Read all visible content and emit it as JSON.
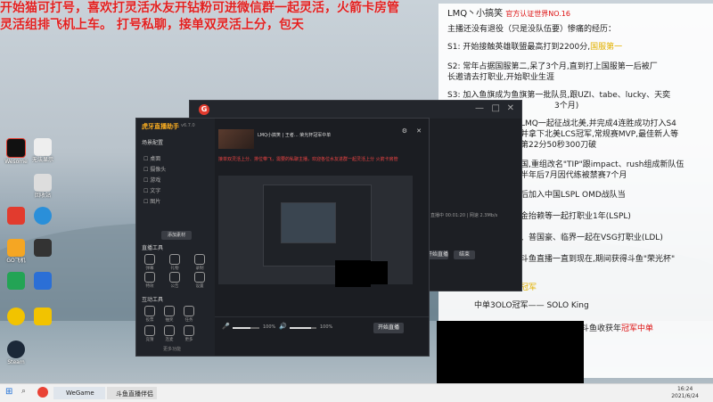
{
  "announcement": {
    "line1": "开始猫可打号，喜欢打灵活水友开钻粉可进微信群一起灵活，火箭卡房管",
    "line2": "灵活组排飞机上车。 打号私聊，接单双灵活上分，包天"
  },
  "desktop_icons": [
    {
      "label": "Wesome",
      "color": "#111111"
    },
    {
      "label": "无法显示",
      "color": "#e8e8e8"
    },
    {
      "label": "回收站",
      "color": "#dddddd"
    },
    {
      "label": "",
      "color": "#2a8fd9"
    },
    {
      "label": "",
      "color": "#e23b2e"
    },
    {
      "label": "GO飞机",
      "color": "#f5a623"
    },
    {
      "label": "",
      "color": "#23a455"
    },
    {
      "label": "",
      "color": "#2b6fd6"
    },
    {
      "label": "",
      "color": "#f2c300"
    },
    {
      "label": "Steam",
      "color": "#1b2838"
    }
  ],
  "bio": {
    "name": "LMQ丶小搞笑",
    "badge": "官方认证世界NO.16",
    "intro": "主播还没有退役（只是没队伍要）惨痛的经历：",
    "s1": "S1:  开始接触英雄联盟最高打到2200分,",
    "s1_hl": "国服第一",
    "s2a": "S2:  常年占据国服第二,呆了3个月,直到打上国服第一后被厂",
    "s2b": "长邀请去打职业,开始职业生涯",
    "s3a": "S3:  加入鱼旗成为鱼旗第一批队员,跟UZI、tabe、lucky、天奕",
    "s3b": "3个月)",
    "l1": "LMQ一起征战北美,并完成4连胜成功打入S4",
    "l2": "并拿下北美LCS冠军,常规赛MVP,最佳新人等",
    "l3": "第22分50秒300刀破",
    "l4": "国,重组改名\"TIP\"跟impact、rush组成新队伍",
    "l5": "半年后7月因代练被禁赛7个月",
    "l6": "后加入中国LSPL OMD战队当",
    "l7": "金抬赖等一起打职业1年(LSPL)",
    "l8": "、普国豪、临界一起在VSG打职业(LDL)",
    "l9": "斗鱼直播一直到现在,期间获得斗鱼\"荣光杯\"",
    "l10": "冠军",
    "l11": "中单3OLO冠军——   SOLO King",
    "l12": "斗鱼收获年",
    "l12_hl": "冠军中单"
  },
  "back_window": {
    "logo": "G",
    "status": "直播中 00:01:20 | 网速 2.3Mb/s",
    "buttons": [
      "开始直播",
      "结束"
    ]
  },
  "front_window": {
    "brand": "虎牙直播助手",
    "version": "v6.7.0",
    "scene_header": "场景配置",
    "scenes": [
      "桌面",
      "摄像头",
      "游戏",
      "文字",
      "图片"
    ],
    "scene_add": "添加素材",
    "tools_header": "直播工具",
    "tools": [
      "弹幕",
      "礼物",
      "录制",
      "特效",
      "公告",
      "设置"
    ],
    "tools2_header": "互动工具",
    "tools2": [
      "投票",
      "抽奖",
      "任务",
      "竞猜",
      "连麦",
      "更多"
    ],
    "more": "更多功能",
    "room_title": "LMQ小搞笑 | 王者... 荣光杯冠军中单",
    "caption": "接单双灵活上分、排位带飞，需要的私聊主播，欢迎各位水友进群一起灵活上分 火箭卡房管",
    "volume1_label": "麦克风",
    "volume1": 0.65,
    "volume1_txt": "100%",
    "volume2_label": "音量",
    "volume2": 0.8,
    "volume2_txt": "100%",
    "start_button": "开始直播"
  },
  "taskbar": {
    "items": [
      "WeGame",
      "斗鱼直播伴侣"
    ],
    "time": "16:24",
    "date": "2021/6/24"
  }
}
